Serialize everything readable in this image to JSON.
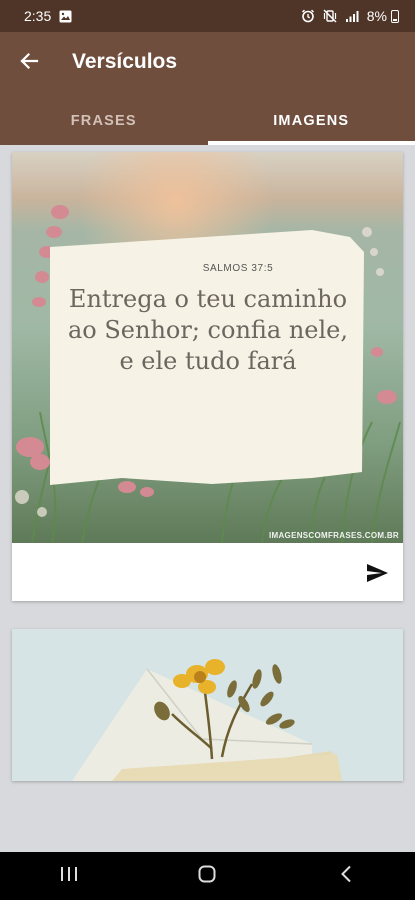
{
  "status_bar": {
    "time": "2:35",
    "battery": "8%",
    "icons": [
      "gallery-icon",
      "alarm-icon",
      "vibrate-mute-icon",
      "signal-icon",
      "battery-icon"
    ]
  },
  "app_bar": {
    "back_icon": "arrow-back-icon",
    "title": "Versículos",
    "tabs": [
      {
        "label": "FRASES",
        "active": false
      },
      {
        "label": "IMAGENS",
        "active": true
      }
    ]
  },
  "cards": [
    {
      "reference": "SALMOS 37:5",
      "verse": "Entrega o teu caminho ao Senhor; confia nele, e ele tudo fará",
      "watermark": "IMAGENSCOMFRASES.COM.BR",
      "share_icon": "send-icon"
    },
    {
      "image": "envelope-flower-photo"
    }
  ],
  "nav_bar": {
    "icons": [
      "recent-apps-icon",
      "home-icon",
      "back-icon"
    ]
  },
  "colors": {
    "status_bar": "#4f3528",
    "app_bar": "#6f4e3e",
    "background": "#d7d9dc"
  }
}
